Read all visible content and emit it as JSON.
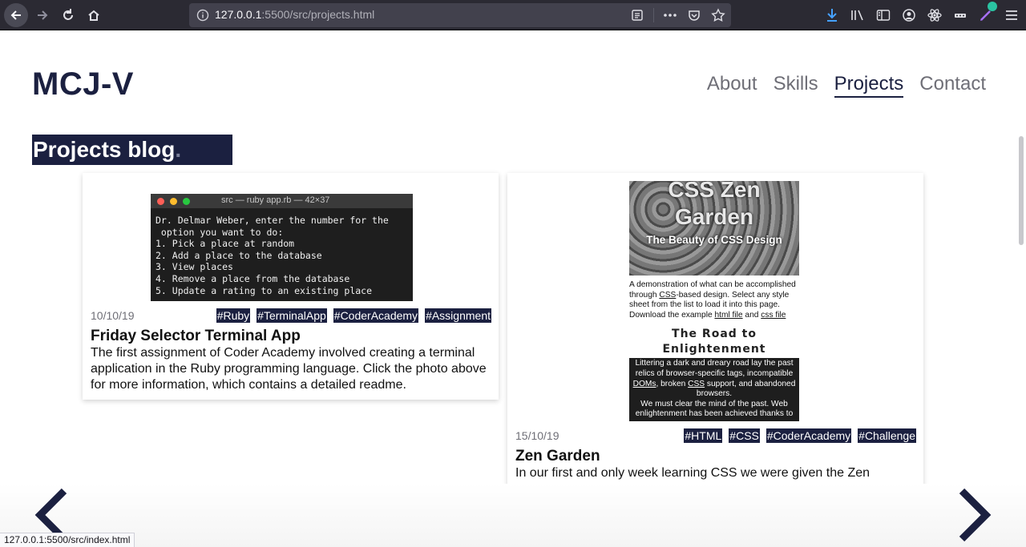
{
  "browser": {
    "url_host": "127.0.0.1",
    "url_rest": ":5500/src/projects.html",
    "status_url": "127.0.0.1:5500/src/index.html"
  },
  "site": {
    "logo": "MCJ-V",
    "nav": [
      {
        "label": "About"
      },
      {
        "label": "Skills"
      },
      {
        "label": "Projects",
        "active": true
      },
      {
        "label": "Contact"
      }
    ]
  },
  "blog": {
    "title": "Projects blog",
    "title_dot": "."
  },
  "posts": [
    {
      "date": "10/10/19",
      "tags": [
        "#Ruby",
        "#TerminalApp",
        "#CoderAcademy",
        "#Assignment"
      ],
      "title": "Friday Selector Terminal App",
      "text": "The first assignment of Coder Academy involved creating a terminal application in the Ruby programming language. Click the photo above for more information, which contains a detailed readme.",
      "screenshot": {
        "window_title": "src — ruby app.rb — 42×37",
        "lines": "Dr. Delmar Weber, enter the number for the\n option you want to do:\n1. Pick a place at random\n2. Add a place to the database\n3. View places\n4. Remove a place from the database\n5. Update a rating to an existing place"
      }
    },
    {
      "date": "15/10/19",
      "tags": [
        "#HTML",
        "#CSS",
        "#CoderAcademy",
        "#Challenge"
      ],
      "title": "Zen Garden",
      "text": "In our first and only week learning CSS we were given the Zen",
      "screenshot": {
        "heading": "CSS Zen Garden",
        "subheading": "The Beauty of CSS Design",
        "intro_1": "A demonstration of what can be accomplished through ",
        "intro_css": "CSS",
        "intro_2": "-based design. Select any style sheet from the list to load it into this page.",
        "download_1": "Download the example ",
        "html_link": "html file",
        "download_and": " and ",
        "css_link": "css file",
        "road": "The Road to Enlightenment",
        "dark_1": "Littering a dark and dreary road lay the past relics of browser-specific tags, incompatible ",
        "doms": "DOMs",
        "dark_2": ", broken ",
        "css2": "CSS",
        "dark_3": " support, and abandoned browsers.",
        "dark_4": "We must clear the mind of the past. Web enlightenment has been achieved thanks to"
      }
    }
  ],
  "colors": {
    "brand": "#1b2040",
    "muted": "#6f6f77"
  }
}
